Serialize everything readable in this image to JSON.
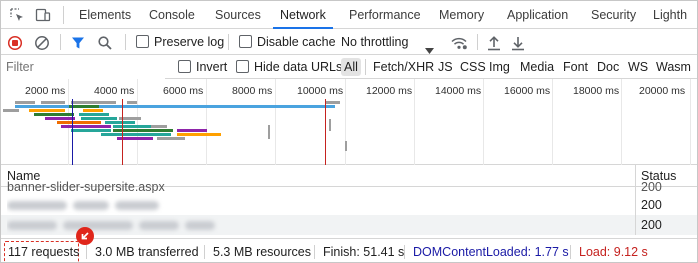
{
  "tabs": {
    "items": [
      {
        "label": "Elements"
      },
      {
        "label": "Console"
      },
      {
        "label": "Sources"
      },
      {
        "label": "Network"
      },
      {
        "label": "Performance"
      },
      {
        "label": "Memory"
      },
      {
        "label": "Application"
      },
      {
        "label": "Security"
      },
      {
        "label": "Lighth"
      }
    ],
    "active": "Network"
  },
  "toolbar": {
    "preserve_log_label": "Preserve log",
    "disable_cache_label": "Disable cache",
    "throttling_value": "No throttling",
    "preserve_log_checked": false,
    "disable_cache_checked": false
  },
  "filter": {
    "placeholder": "Filter",
    "invert_label": "Invert",
    "hide_data_urls_label": "Hide data URLs",
    "types": [
      "All",
      "Fetch/XHR",
      "JS",
      "CSS",
      "Img",
      "Media",
      "Font",
      "Doc",
      "WS",
      "Wasm"
    ]
  },
  "overview": {
    "tick_labels": [
      "2000 ms",
      "4000 ms",
      "6000 ms",
      "8000 ms",
      "10000 ms",
      "12000 ms",
      "14000 ms",
      "16000 ms",
      "18000 ms",
      "20000 ms"
    ]
  },
  "table": {
    "headers": {
      "name": "Name",
      "status": "Status"
    },
    "rows": [
      {
        "name": "banner-slider-supersite.aspx",
        "status": "200"
      },
      {
        "name": "",
        "status": "200"
      },
      {
        "name": "",
        "status": "200"
      }
    ]
  },
  "statusbar": {
    "requests": "117 requests",
    "transferred": "3.0 MB transferred",
    "resources": "5.3 MB resources",
    "finish": "Finish: 51.41 s",
    "dom_content_loaded": "DOMContentLoaded: 1.77 s",
    "load": "Load: 9.12 s"
  },
  "colors": {
    "accent": "#1a73e8",
    "dom_content_loaded": "#1a1aa6",
    "load": "#c5221f",
    "record": "#d93025",
    "highlight": "#d93025"
  }
}
